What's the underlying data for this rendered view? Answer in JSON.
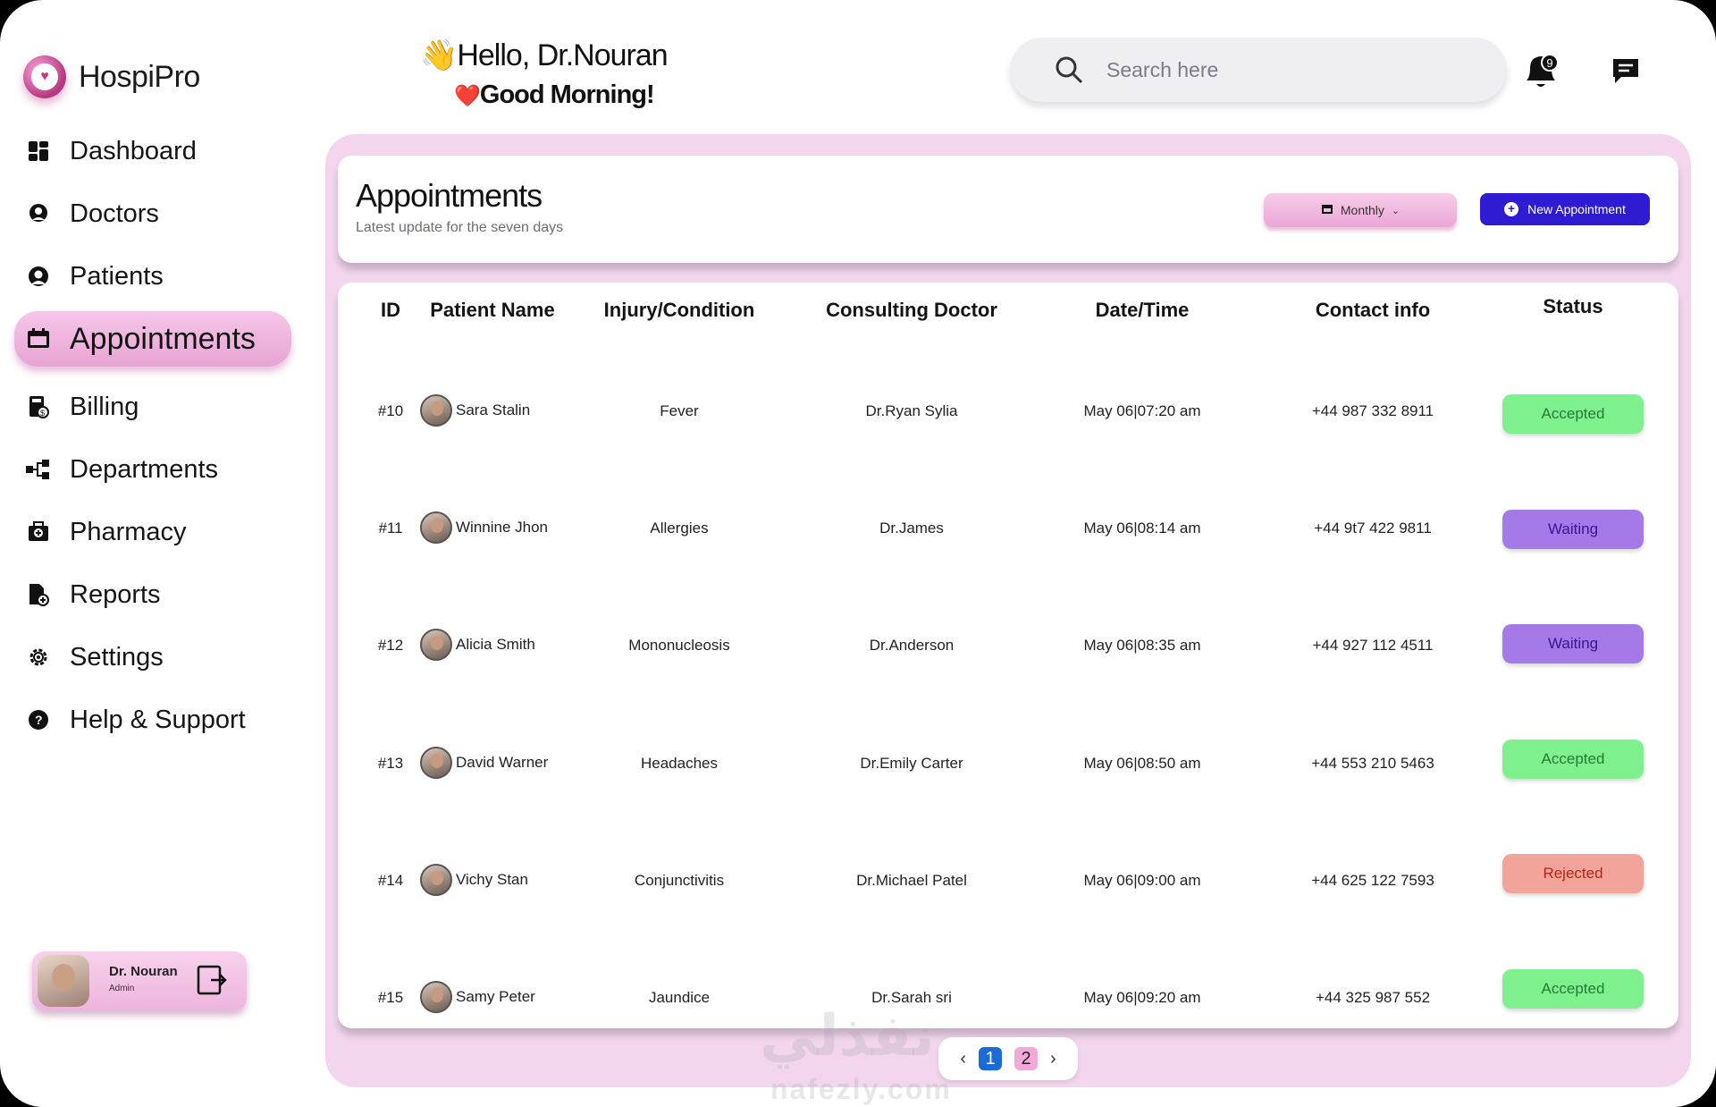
{
  "brand": {
    "name": "HospiPro"
  },
  "header": {
    "greeting": "Hello, Dr.Nouran",
    "greeting_emoji": "👋",
    "subgreeting": "Good Morning!",
    "subgreeting_emoji": "❤️",
    "search_placeholder": "Search here",
    "notification_count": "9"
  },
  "sidebar": {
    "items": [
      {
        "label": "Dashboard",
        "icon": "dashboard-icon"
      },
      {
        "label": "Doctors",
        "icon": "doctor-icon"
      },
      {
        "label": "Patients",
        "icon": "patient-icon"
      },
      {
        "label": "Appointments",
        "icon": "calendar-icon",
        "active": true
      },
      {
        "label": "Billing",
        "icon": "billing-icon"
      },
      {
        "label": "Departments",
        "icon": "departments-icon"
      },
      {
        "label": "Pharmacy",
        "icon": "pharmacy-icon"
      },
      {
        "label": "Reports",
        "icon": "reports-icon"
      },
      {
        "label": "Settings",
        "icon": "gear-icon"
      },
      {
        "label": "Help & Support",
        "icon": "help-icon"
      }
    ],
    "profile": {
      "name": "Dr. Nouran",
      "role": "Admin"
    }
  },
  "appointments": {
    "title": "Appointments",
    "subtitle": "Latest update for the seven days",
    "filter_label": "Monthly",
    "new_button": "New Appointment",
    "columns": [
      "ID",
      "Patient Name",
      "Injury/Condition",
      "Consulting Doctor",
      "Date/Time",
      "Contact info",
      "Status"
    ],
    "rows": [
      {
        "id": "#10",
        "patient": "Sara Stalin",
        "condition": "Fever",
        "doctor": "Dr.Ryan Sylia",
        "datetime": "May 06|07:20 am",
        "contact": "+44 987 332 8911",
        "status": "Accepted"
      },
      {
        "id": "#11",
        "patient": "Winnine Jhon",
        "condition": "Allergies",
        "doctor": "Dr.James",
        "datetime": "May 06|08:14 am",
        "contact": "+44 9t7 422 9811",
        "status": "Waiting"
      },
      {
        "id": "#12",
        "patient": "Alicia Smith",
        "condition": "Mononucleosis",
        "doctor": "Dr.Anderson",
        "datetime": "May 06|08:35 am",
        "contact": "+44 927 112 4511",
        "status": "Waiting"
      },
      {
        "id": "#13",
        "patient": "David Warner",
        "condition": "Headaches",
        "doctor": "Dr.Emily Carter",
        "datetime": "May 06|08:50 am",
        "contact": "+44 553 210 5463",
        "status": "Accepted"
      },
      {
        "id": "#14",
        "patient": "Vichy Stan",
        "condition": "Conjunctivitis",
        "doctor": "Dr.Michael Patel",
        "datetime": "May 06|09:00 am",
        "contact": "+44 625 122 7593",
        "status": "Rejected"
      },
      {
        "id": "#15",
        "patient": "Samy Peter",
        "condition": "Jaundice",
        "doctor": "Dr.Sarah sri",
        "datetime": "May 06|09:20 am",
        "contact": "+44 325 987 552",
        "status": "Accepted"
      }
    ],
    "pagination": {
      "pages": [
        "1",
        "2"
      ],
      "current": "1"
    }
  },
  "watermark": {
    "arabic": "نفذلي",
    "latin": "nafezly.com"
  }
}
